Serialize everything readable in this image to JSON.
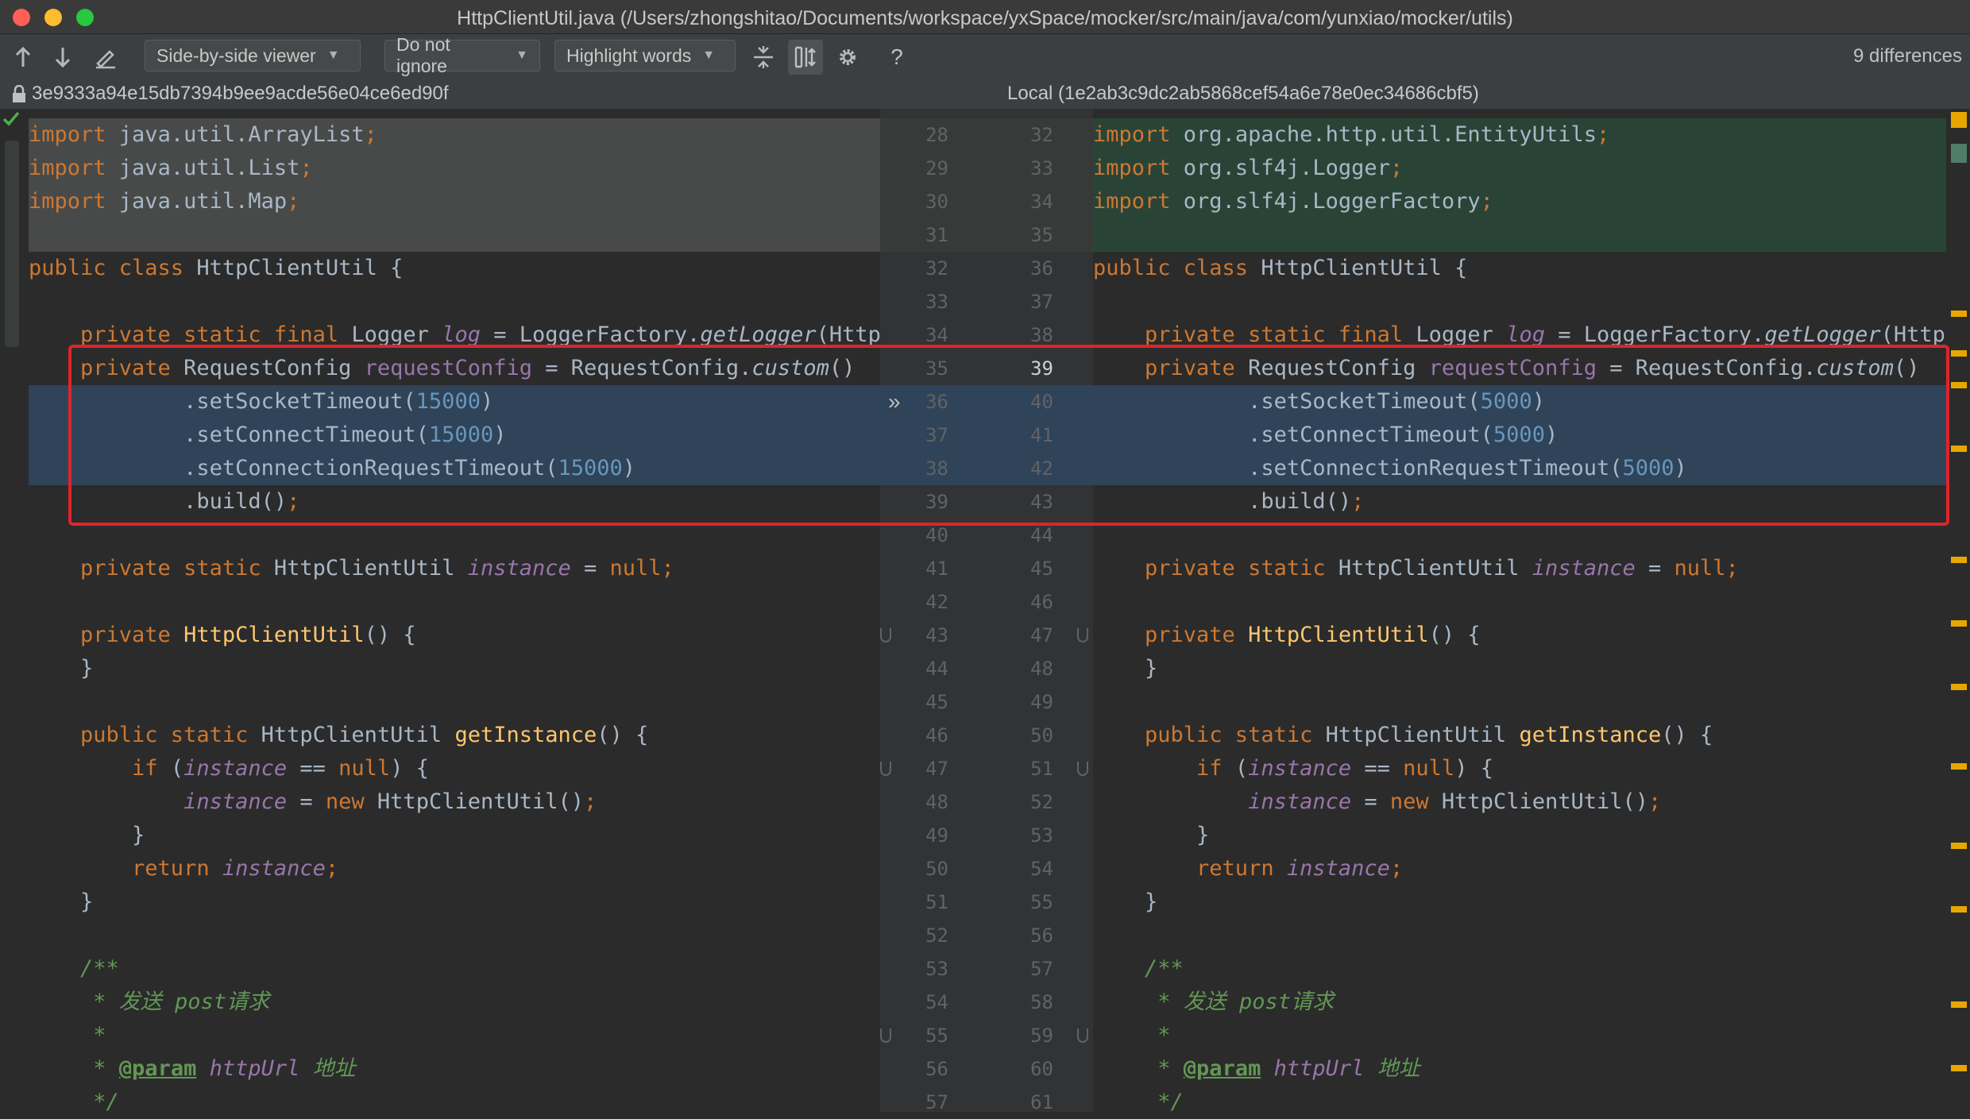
{
  "window": {
    "title": "HttpClientUtil.java (/Users/zhongshitao/Documents/workspace/yxSpace/mocker/src/main/java/com/yunxiao/mocker/utils)"
  },
  "toolbar": {
    "viewer": "Side-by-side viewer",
    "ignore": "Do not ignore",
    "highlight": "Highlight words",
    "differences": "9 differences",
    "help": "?"
  },
  "left_header": "3e9333a94e15db7394b9ee9acde56e04ce6ed90f",
  "right_header": "Local (1e2ab3c9dc2ab5868cef54a6e78e0ec34686cbf5)",
  "colors": {
    "added": "#294436",
    "deleted": "#484a4a",
    "modified": "#2f4359",
    "highlight_box": "#e0232b"
  },
  "left_lines": [
    [
      [
        "kw",
        "import "
      ],
      [
        "",
        "java.util.ArrayList"
      ],
      [
        "kw",
        ";"
      ]
    ],
    [
      [
        "kw",
        "import "
      ],
      [
        "",
        "java.util.List"
      ],
      [
        "kw",
        ";"
      ]
    ],
    [
      [
        "kw",
        "import "
      ],
      [
        "",
        "java.util.Map"
      ],
      [
        "kw",
        ";"
      ]
    ],
    [],
    [
      [
        "kw",
        "public class "
      ],
      [
        "",
        "HttpClientUtil {"
      ]
    ],
    [],
    [
      [
        "kw",
        "    private static final "
      ],
      [
        "",
        "Logger "
      ],
      [
        "fld it",
        "log"
      ],
      [
        "",
        " = LoggerFactory."
      ],
      [
        "it",
        "getLogger"
      ],
      [
        "",
        "(Http"
      ]
    ],
    [
      [
        "kw",
        "    private "
      ],
      [
        "",
        "RequestConfig "
      ],
      [
        "fld",
        "requestConfig"
      ],
      [
        "",
        " = RequestConfig."
      ],
      [
        "it",
        "custom"
      ],
      [
        "",
        "()"
      ]
    ],
    [
      [
        "",
        "            .setSocketTimeout("
      ],
      [
        "num",
        "15000"
      ],
      [
        "",
        ")"
      ]
    ],
    [
      [
        "",
        "            .setConnectTimeout("
      ],
      [
        "num",
        "15000"
      ],
      [
        "",
        ")"
      ]
    ],
    [
      [
        "",
        "            .setConnectionRequestTimeout("
      ],
      [
        "num",
        "15000"
      ],
      [
        "",
        ")"
      ]
    ],
    [
      [
        "",
        "            .build()"
      ],
      [
        "kw",
        ";"
      ]
    ],
    [],
    [
      [
        "kw",
        "    private static "
      ],
      [
        "",
        "HttpClientUtil "
      ],
      [
        "fld it",
        "instance"
      ],
      [
        "",
        " = "
      ],
      [
        "kw",
        "null;"
      ]
    ],
    [],
    [
      [
        "kw",
        "    private "
      ],
      [
        "fn",
        "HttpClientUtil"
      ],
      [
        "",
        "() {"
      ]
    ],
    [
      [
        "",
        "    }"
      ]
    ],
    [],
    [
      [
        "kw",
        "    public static "
      ],
      [
        "",
        "HttpClientUtil "
      ],
      [
        "fn",
        "getInstance"
      ],
      [
        "",
        "() {"
      ]
    ],
    [
      [
        "kw",
        "        if "
      ],
      [
        "",
        "("
      ],
      [
        "fld it",
        "instance"
      ],
      [
        "",
        " == "
      ],
      [
        "kw",
        "null"
      ],
      [
        "",
        ") {"
      ]
    ],
    [
      [
        "fld it",
        "            instance"
      ],
      [
        "",
        " = "
      ],
      [
        "kw",
        "new "
      ],
      [
        "",
        "HttpClientUtil()"
      ],
      [
        "kw",
        ";"
      ]
    ],
    [
      [
        "",
        "        }"
      ]
    ],
    [
      [
        "kw",
        "        return "
      ],
      [
        "fld it",
        "instance"
      ],
      [
        "kw",
        ";"
      ]
    ],
    [
      [
        "",
        "    }"
      ]
    ],
    [],
    [
      [
        "doc",
        "    /**"
      ]
    ],
    [
      [
        "doc",
        "     * 发送 post请求"
      ]
    ],
    [
      [
        "doc",
        "     *"
      ]
    ],
    [
      [
        "doc",
        "     * "
      ],
      [
        "tag",
        "@param"
      ],
      [
        "doc",
        " "
      ],
      [
        "fld it",
        "httpUrl"
      ],
      [
        "doc",
        " 地址"
      ]
    ],
    [
      [
        "doc",
        "     */"
      ]
    ]
  ],
  "right_lines": [
    [
      [
        "kw",
        "import "
      ],
      [
        "",
        "org.apache.http.util.EntityUtils"
      ],
      [
        "kw",
        ";"
      ]
    ],
    [
      [
        "kw",
        "import "
      ],
      [
        "",
        "org.slf4j.Logger"
      ],
      [
        "kw",
        ";"
      ]
    ],
    [
      [
        "kw",
        "import "
      ],
      [
        "",
        "org.slf4j.LoggerFactory"
      ],
      [
        "kw",
        ";"
      ]
    ],
    [],
    [
      [
        "kw",
        "public class "
      ],
      [
        "",
        "HttpClientUtil {"
      ]
    ],
    [],
    [
      [
        "kw",
        "    private static final "
      ],
      [
        "",
        "Logger "
      ],
      [
        "fld it",
        "log"
      ],
      [
        "",
        " = LoggerFactory."
      ],
      [
        "it",
        "getLogger"
      ],
      [
        "",
        "(HttpCl"
      ]
    ],
    [
      [
        "kw",
        "    private "
      ],
      [
        "",
        "RequestConfig "
      ],
      [
        "fld",
        "requestConfig"
      ],
      [
        "",
        " = RequestConfig."
      ],
      [
        "it",
        "custom"
      ],
      [
        "",
        "()"
      ]
    ],
    [
      [
        "",
        "            .setSocketTimeout("
      ],
      [
        "num",
        "5000"
      ],
      [
        "",
        ")"
      ]
    ],
    [
      [
        "",
        "            .setConnectTimeout("
      ],
      [
        "num",
        "5000"
      ],
      [
        "",
        ")"
      ]
    ],
    [
      [
        "",
        "            .setConnectionRequestTimeout("
      ],
      [
        "num",
        "5000"
      ],
      [
        "",
        ")"
      ]
    ],
    [
      [
        "",
        "            .build()"
      ],
      [
        "kw",
        ";"
      ]
    ],
    [],
    [
      [
        "kw",
        "    private static "
      ],
      [
        "",
        "HttpClientUtil "
      ],
      [
        "fld it",
        "instance"
      ],
      [
        "",
        " = "
      ],
      [
        "kw",
        "null;"
      ]
    ],
    [],
    [
      [
        "kw",
        "    private "
      ],
      [
        "fn",
        "HttpClientUtil"
      ],
      [
        "",
        "() {"
      ]
    ],
    [
      [
        "",
        "    }"
      ]
    ],
    [],
    [
      [
        "kw",
        "    public static "
      ],
      [
        "",
        "HttpClientUtil "
      ],
      [
        "fn",
        "getInstance"
      ],
      [
        "",
        "() {"
      ]
    ],
    [
      [
        "kw",
        "        if "
      ],
      [
        "",
        "("
      ],
      [
        "fld it",
        "instance"
      ],
      [
        "",
        " == "
      ],
      [
        "kw",
        "null"
      ],
      [
        "",
        ") {"
      ]
    ],
    [
      [
        "fld it",
        "            instance"
      ],
      [
        "",
        " = "
      ],
      [
        "kw",
        "new "
      ],
      [
        "",
        "HttpClientUtil()"
      ],
      [
        "kw",
        ";"
      ]
    ],
    [
      [
        "",
        "        }"
      ]
    ],
    [
      [
        "kw",
        "        return "
      ],
      [
        "fld it",
        "instance"
      ],
      [
        "kw",
        ";"
      ]
    ],
    [
      [
        "",
        "    }"
      ]
    ],
    [],
    [
      [
        "doc",
        "    /**"
      ]
    ],
    [
      [
        "doc",
        "     * 发送 post请求"
      ]
    ],
    [
      [
        "doc",
        "     *"
      ]
    ],
    [
      [
        "doc",
        "     * "
      ],
      [
        "tag",
        "@param"
      ],
      [
        "doc",
        " "
      ],
      [
        "fld it",
        "httpUrl"
      ],
      [
        "doc",
        " 地址"
      ]
    ],
    [
      [
        "doc",
        "     */"
      ]
    ]
  ],
  "left_numbers": [
    "28",
    "29",
    "30",
    "31",
    "32",
    "33",
    "34",
    "35",
    "36",
    "37",
    "38",
    "39",
    "40",
    "41",
    "42",
    "43",
    "44",
    "45",
    "46",
    "47",
    "48",
    "49",
    "50",
    "51",
    "52",
    "53",
    "54",
    "55",
    "56",
    "57"
  ],
  "right_numbers": [
    "32",
    "33",
    "34",
    "35",
    "36",
    "37",
    "38",
    "39",
    "40",
    "41",
    "42",
    "43",
    "44",
    "45",
    "46",
    "47",
    "48",
    "49",
    "50",
    "51",
    "52",
    "53",
    "54",
    "55",
    "56",
    "57",
    "58",
    "59",
    "60",
    "61"
  ]
}
